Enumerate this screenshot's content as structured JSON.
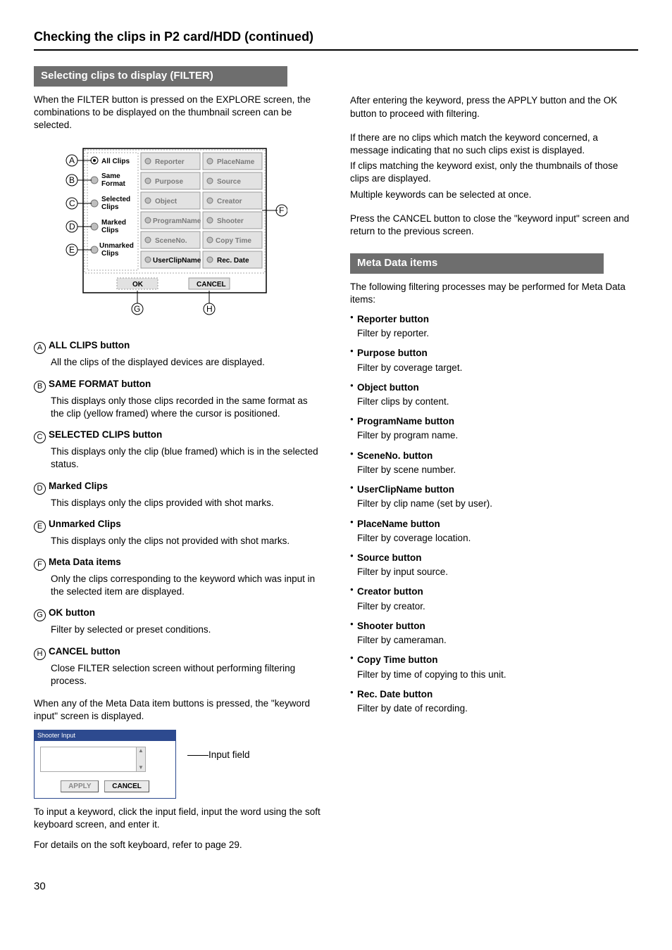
{
  "header": {
    "title": "Checking the clips in P2 card/HDD (continued)"
  },
  "section_filter": {
    "title": "Selecting clips to display (FILTER)",
    "intro": "When the FILTER button is pressed on the EXPLORE screen, the combinations to be displayed on the thumbnail screen can be selected.",
    "dialog": {
      "left_items": {
        "a": "All Clips",
        "b": "Same Format",
        "c": "Selected Clips",
        "d": "Marked Clips",
        "e": "Unmarked Clips"
      },
      "buttons": {
        "ok": "OK",
        "cancel": "CANCEL"
      },
      "meta": {
        "reporter": "Reporter",
        "placename": "PlaceName",
        "purpose": "Purpose",
        "source": "Source",
        "object": "Object",
        "creator": "Creator",
        "programname": "ProgramName",
        "shooter": "Shooter",
        "sceneno": "SceneNo.",
        "copytime": "Copy Time",
        "userclipname": "UserClipName",
        "recdate": "Rec. Date"
      },
      "callouts": {
        "a": "A",
        "b": "B",
        "c": "C",
        "d": "D",
        "e": "E",
        "f": "F",
        "g": "G",
        "h": "H"
      }
    },
    "items": {
      "a": {
        "head": "ALL CLIPS button",
        "body": "All the clips of the displayed devices are displayed."
      },
      "b": {
        "head": "SAME FORMAT button",
        "body": "This displays only those clips recorded in the same format as the clip (yellow framed) where the cursor is positioned."
      },
      "c": {
        "head": "SELECTED CLIPS button",
        "body": "This displays only the clip (blue framed) which is in the selected status."
      },
      "d": {
        "head": "Marked Clips",
        "body": "This displays only the clips provided with shot marks."
      },
      "e": {
        "head": "Unmarked Clips",
        "body": "This displays only the clips not provided with shot marks."
      },
      "f": {
        "head": "Meta Data items",
        "body": "Only the clips corresponding to the keyword which was input in the selected item are displayed."
      },
      "g": {
        "head": "OK button",
        "body": "Filter by selected or preset conditions."
      },
      "h": {
        "head": "CANCEL button",
        "body": "Close FILTER selection screen without performing filtering process."
      }
    },
    "keyword_intro": "When any of the Meta Data item buttons is pressed, the \"keyword input\" screen is displayed.",
    "keyword_dialog": {
      "title": "Shooter Input",
      "apply": "APPLY",
      "cancel": "CANCEL",
      "callout": "Input field"
    },
    "keyword_after1": "To input a keyword, click the input field, input the word using the soft keyboard screen, and enter it.",
    "keyword_after2": "For details on the soft keyboard, refer to page 29."
  },
  "right": {
    "after1": "After entering the keyword, press the APPLY button and the OK button to proceed with filtering.",
    "after2a": "If there are no clips which match the keyword concerned, a message indicating that no such clips exist is displayed.",
    "after2b": "If clips matching the keyword exist, only the thumbnails of those clips are displayed.",
    "after2c": "Multiple keywords can be selected at once.",
    "after3": "Press the CANCEL button to close the \"keyword input\" screen and return to the previous screen.",
    "meta_section_title": "Meta Data items",
    "meta_intro": "The following filtering processes may be performed for Meta Data items:",
    "meta_items": [
      {
        "head": "Reporter button",
        "body": "Filter by reporter."
      },
      {
        "head": "Purpose button",
        "body": "Filter by coverage target."
      },
      {
        "head": "Object button",
        "body": "Filter clips by content."
      },
      {
        "head": "ProgramName button",
        "body": "Filter by program name."
      },
      {
        "head": "SceneNo. button",
        "body": "Filter by scene number."
      },
      {
        "head": "UserClipName button",
        "body": "Filter by clip name (set by user)."
      },
      {
        "head": "PlaceName button",
        "body": "Filter by coverage location."
      },
      {
        "head": "Source button",
        "body": "Filter by input source."
      },
      {
        "head": "Creator button",
        "body": "Filter by creator."
      },
      {
        "head": "Shooter button",
        "body": "Filter by cameraman."
      },
      {
        "head": "Copy Time button",
        "body": "Filter by time of copying to this unit."
      },
      {
        "head": "Rec. Date button",
        "body": "Filter by date of recording."
      }
    ]
  },
  "page_number": "30"
}
